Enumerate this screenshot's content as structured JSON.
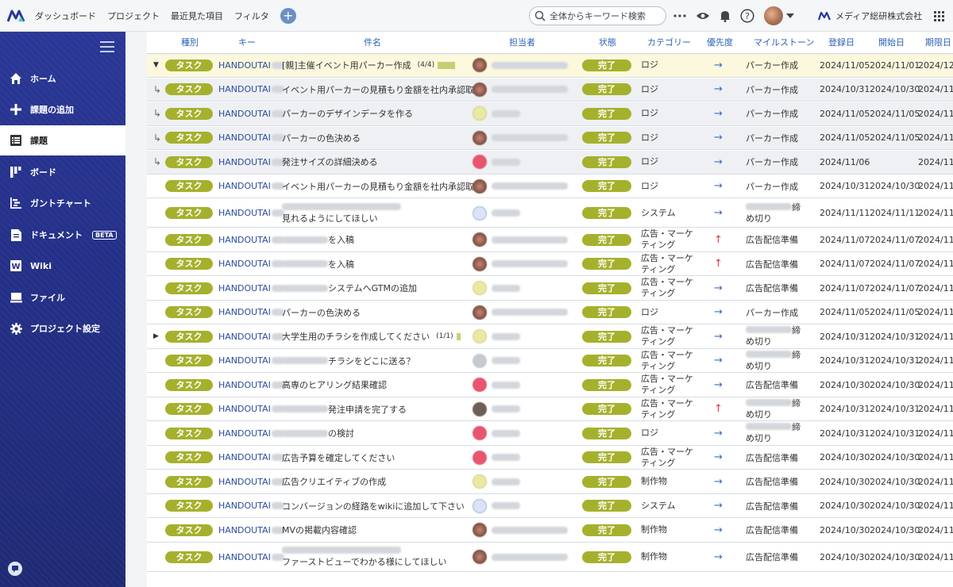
{
  "topbar": {
    "nav": [
      "ダッシュボード",
      "プロジェクト",
      "最近見た項目",
      "フィルタ"
    ],
    "search_placeholder": "全体からキーワード検索",
    "company": "メディア総研株式会社",
    "brand_color": "#2a3796"
  },
  "sidebar": {
    "items": [
      {
        "label": "ホーム",
        "icon": "home-icon"
      },
      {
        "label": "課題の追加",
        "icon": "plus-icon"
      },
      {
        "label": "課題",
        "icon": "list-icon",
        "active": true
      },
      {
        "label": "ボード",
        "icon": "board-icon"
      },
      {
        "label": "ガントチャート",
        "icon": "gantt-icon"
      },
      {
        "label": "ドキュメント",
        "icon": "document-icon",
        "badge": "BETA"
      },
      {
        "label": "Wiki",
        "icon": "wiki-icon"
      },
      {
        "label": "ファイル",
        "icon": "file-icon"
      },
      {
        "label": "プロジェクト設定",
        "icon": "gear-icon"
      }
    ]
  },
  "table": {
    "headers": [
      "種別",
      "キー",
      "件名",
      "担当者",
      "状態",
      "カテゴリー",
      "優先度",
      "マイルストーン",
      "登録日",
      "開始日",
      "期限日"
    ],
    "rows": [
      {
        "level": "parent-open",
        "type": "タスク",
        "key": "HANDOUTAI",
        "summary": "[親]主催イベント用パーカー作成",
        "count": "(4/4)",
        "assignee": "photo",
        "status": "完了",
        "category": "ロジ",
        "priority": "→",
        "milestone": "パーカー作成",
        "created": "2024/11/05",
        "start": "2024/11/01",
        "due": "2024/12/0"
      },
      {
        "level": "sub",
        "type": "タスク",
        "key": "HANDOUTAI",
        "summary": "イベント用パーカーの見積もり金額を社内承認取る",
        "assignee": "photo",
        "status": "完了",
        "category": "ロジ",
        "priority": "→",
        "milestone": "パーカー作成",
        "created": "2024/10/31",
        "start": "2024/10/30",
        "due": "2024/11/0"
      },
      {
        "level": "sub",
        "type": "タスク",
        "key": "HANDOUTAI",
        "summary": "パーカーのデザインデータを作る",
        "assignee": "yellow",
        "status": "完了",
        "category": "ロジ",
        "priority": "→",
        "milestone": "パーカー作成",
        "created": "2024/11/05",
        "start": "2024/11/05",
        "due": "2024/11/1"
      },
      {
        "level": "sub",
        "type": "タスク",
        "key": "HANDOUTAI",
        "summary": "パーカーの色決める",
        "assignee": "photo",
        "status": "完了",
        "category": "ロジ",
        "priority": "→",
        "milestone": "パーカー作成",
        "created": "2024/11/05",
        "start": "2024/11/05",
        "due": "2024/11/1"
      },
      {
        "level": "sub",
        "type": "タスク",
        "key": "HANDOUTAI",
        "summary": "発注サイズの詳細決める",
        "assignee": "red",
        "status": "完了",
        "category": "ロジ",
        "priority": "→",
        "milestone": "パーカー作成",
        "created": "2024/11/06",
        "start": "",
        "due": "2024/11/1"
      },
      {
        "level": "normal",
        "type": "タスク",
        "key": "HANDOUTAI",
        "summary": "イベント用パーカーの見積もり金額を社内承認取る",
        "assignee": "photo",
        "status": "完了",
        "category": "ロジ",
        "priority": "→",
        "milestone": "パーカー作成",
        "created": "2024/10/31",
        "start": "2024/10/30",
        "due": "2024/11/0"
      },
      {
        "level": "normal",
        "type": "タスク",
        "key": "HANDOUTAI",
        "summary": "見れるようにしてほしい",
        "summary_blur_prefix": true,
        "multiline": true,
        "assignee": "blue",
        "status": "完了",
        "category": "システム",
        "priority": "→",
        "milestone": "締め切り",
        "milestone_blur": true,
        "created": "2024/11/11",
        "start": "2024/11/11",
        "due": "2024/11/1",
        "height": 36
      },
      {
        "level": "normal",
        "type": "タスク",
        "key": "HANDOUTAI",
        "summary": "を入稿",
        "summary_blur_prefix": true,
        "assignee": "photo",
        "status": "完了",
        "category": "広告・マーケティング",
        "priority": "↑",
        "milestone": "広告配信準備",
        "created": "2024/11/07",
        "start": "2024/11/07",
        "due": "2024/11/0"
      },
      {
        "level": "normal",
        "type": "タスク",
        "key": "HANDOUTAI",
        "summary": "を入稿",
        "summary_blur_prefix": true,
        "assignee": "photo",
        "status": "完了",
        "category": "広告・マーケティング",
        "priority": "↑",
        "milestone": "広告配信準備",
        "created": "2024/11/07",
        "start": "2024/11/07",
        "due": "2024/11/0"
      },
      {
        "level": "normal",
        "type": "タスク",
        "key": "HANDOUTAI",
        "summary": "システムへGTMの追加",
        "summary_blur_prefix": true,
        "assignee": "yellow",
        "status": "完了",
        "category": "広告・マーケティング",
        "priority": "→",
        "milestone": "広告配信準備",
        "created": "2024/11/07",
        "start": "2024/11/07",
        "due": "2024/11/0"
      },
      {
        "level": "normal",
        "type": "タスク",
        "key": "HANDOUTAI",
        "summary": "パーカーの色決める",
        "assignee": "photo",
        "status": "完了",
        "category": "ロジ",
        "priority": "→",
        "milestone": "パーカー作成",
        "created": "2024/11/05",
        "start": "2024/11/05",
        "due": "2024/11/1"
      },
      {
        "level": "parent-closed",
        "type": "タスク",
        "key": "HANDOUTAI",
        "summary": "大学生用のチラシを作成してください",
        "count": "(1/1)",
        "assignee": "yellow",
        "status": "完了",
        "category": "広告・マーケティング",
        "priority": "→",
        "milestone": "締め切り",
        "milestone_blur": true,
        "created": "2024/10/31",
        "start": "2024/10/31",
        "due": "2024/11/0"
      },
      {
        "level": "normal",
        "type": "タスク",
        "key": "HANDOUTAI",
        "summary": "チラシをどこに送る？",
        "summary_blur_prefix": true,
        "assignee": "gray",
        "status": "完了",
        "category": "広告・マーケティング",
        "priority": "→",
        "milestone": "締め切り",
        "milestone_blur": true,
        "created": "2024/10/31",
        "start": "2024/10/31",
        "due": "2024/11/0"
      },
      {
        "level": "normal",
        "type": "タスク",
        "key": "HANDOUTAI",
        "summary": "高専のヒアリング結果確認",
        "assignee": "red",
        "status": "完了",
        "category": "広告・マーケティング",
        "priority": "→",
        "milestone": "広告配信準備",
        "created": "2024/10/30",
        "start": "2024/10/30",
        "due": "2024/11/0"
      },
      {
        "level": "normal",
        "type": "タスク",
        "key": "HANDOUTAI",
        "summary": "発注申請を完了する",
        "summary_blur_prefix": true,
        "assignee": "dark",
        "status": "完了",
        "category": "広告・マーケティング",
        "priority": "↑",
        "milestone": "締め切り",
        "milestone_blur": true,
        "created": "2024/10/31",
        "start": "2024/10/31",
        "due": "2024/11/0"
      },
      {
        "level": "normal",
        "type": "タスク",
        "key": "HANDOUTAI",
        "summary": "の検討",
        "summary_blur_prefix": true,
        "assignee": "red",
        "status": "完了",
        "category": "ロジ",
        "priority": "→",
        "milestone": "締め切り",
        "milestone_blur": true,
        "created": "2024/10/31",
        "start": "2024/10/31",
        "due": "2024/11/0"
      },
      {
        "level": "normal",
        "type": "タスク",
        "key": "HANDOUTAI",
        "summary": "広告予算を確定してください",
        "assignee": "red",
        "status": "完了",
        "category": "広告・マーケティング",
        "priority": "→",
        "milestone": "広告配信準備",
        "created": "2024/10/30",
        "start": "2024/10/30",
        "due": "2024/11/0"
      },
      {
        "level": "normal",
        "type": "タスク",
        "key": "HANDOUTAI",
        "summary": "広告クリエイティブの作成",
        "assignee": "yellow",
        "status": "完了",
        "category": "制作物",
        "priority": "→",
        "milestone": "広告配信準備",
        "created": "2024/10/30",
        "start": "2024/10/30",
        "due": "2024/11/0"
      },
      {
        "level": "normal",
        "type": "タスク",
        "key": "HANDOUTAI",
        "summary": "コンバージョンの経路をwikiに追加して下さい",
        "assignee": "blue",
        "status": "完了",
        "category": "システム",
        "priority": "→",
        "milestone": "広告配信準備",
        "created": "2024/10/30",
        "start": "2024/10/30",
        "due": "2024/11/0"
      },
      {
        "level": "normal",
        "type": "タスク",
        "key": "HANDOUTAI",
        "summary": "MVの掲載内容確認",
        "assignee": "photo",
        "status": "完了",
        "category": "制作物",
        "priority": "→",
        "milestone": "広告配信準備",
        "created": "2024/10/30",
        "start": "2024/10/30",
        "due": "2024/11/0"
      },
      {
        "level": "normal",
        "type": "タスク",
        "key": "HANDOUTAI",
        "summary": "ファーストビューでわかる様にしてほしい",
        "summary_blur_prefix": true,
        "multiline": true,
        "assignee": "photo",
        "status": "完了",
        "category": "制作物",
        "priority": "→",
        "milestone": "広告配信準備",
        "created": "2024/10/30",
        "start": "2024/10/30",
        "due": "2024/11/0",
        "height": 36
      }
    ]
  }
}
